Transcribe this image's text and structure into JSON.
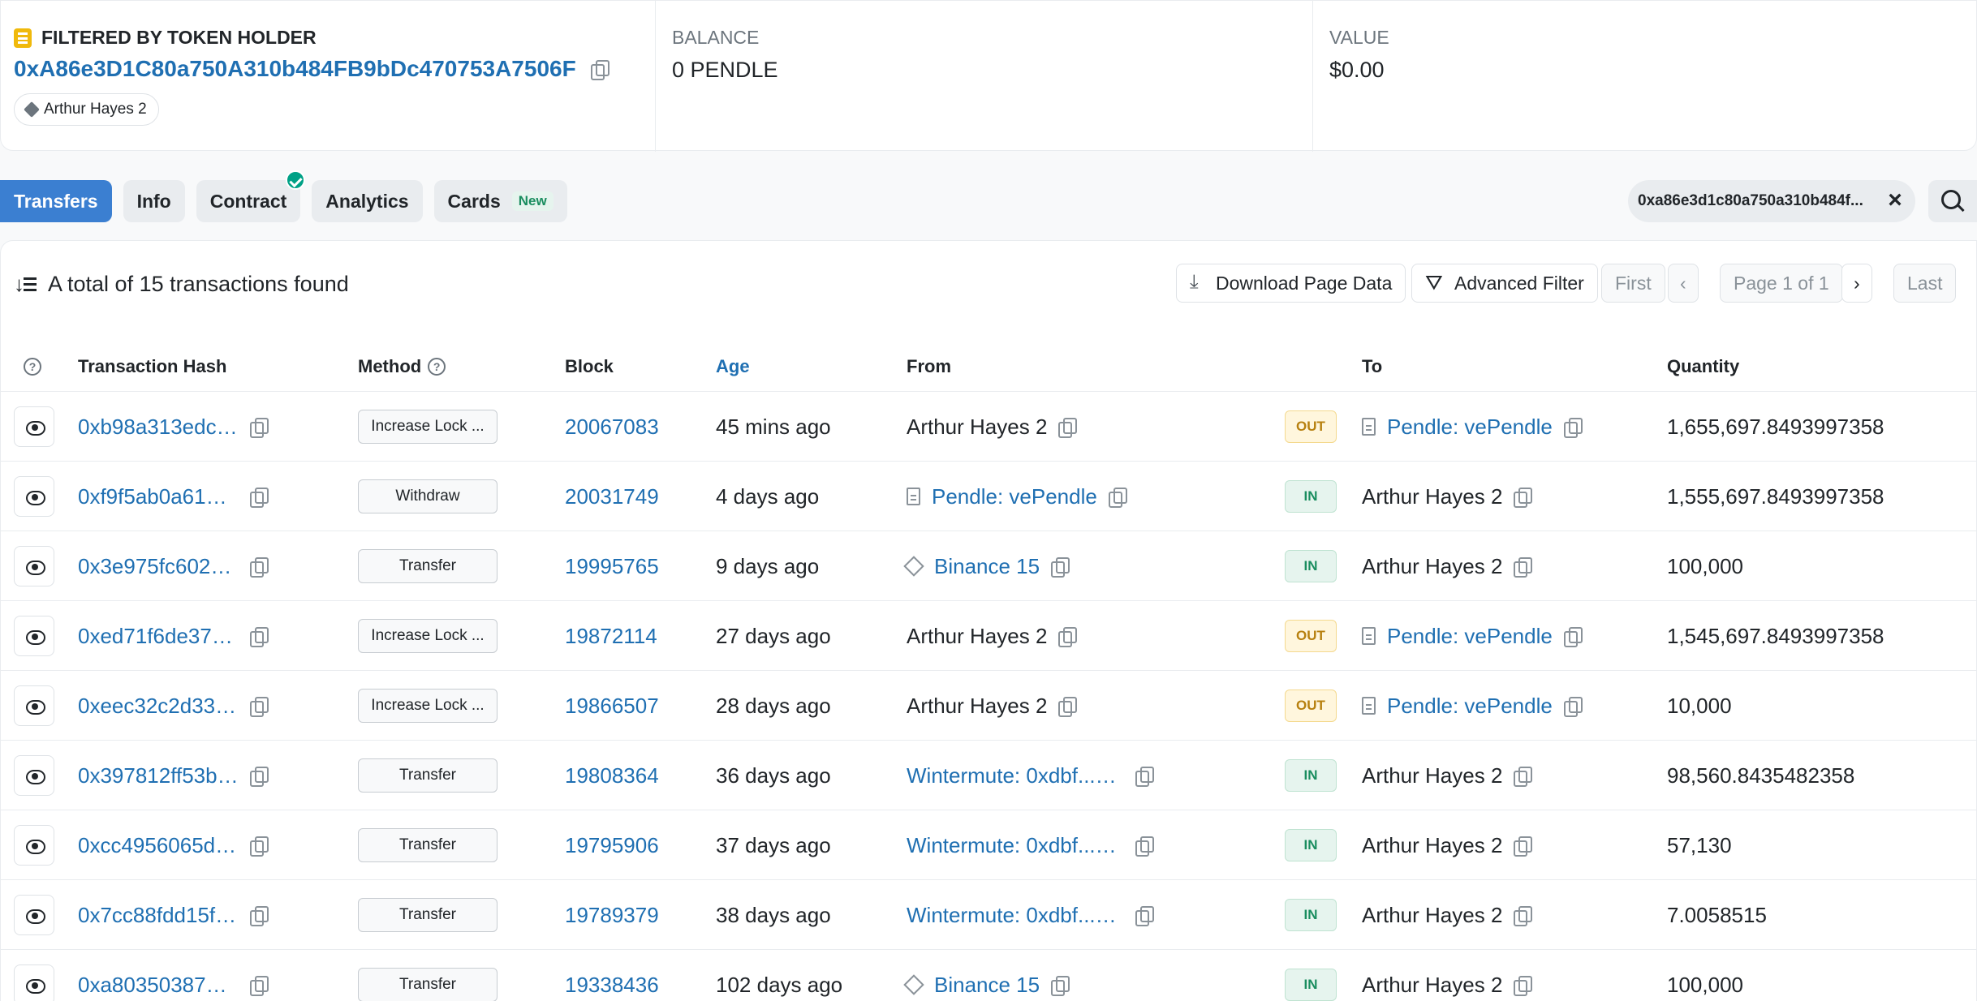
{
  "holder": {
    "heading": "FILTERED BY TOKEN HOLDER",
    "address": "0xA86e3D1C80a750A310b484FB9bDc470753A7506F",
    "tag": "Arthur Hayes 2",
    "balance_label": "BALANCE",
    "balance_value": "0 PENDLE",
    "value_label": "VALUE",
    "value_value": "$0.00"
  },
  "tabs": {
    "transfers": "Transfers",
    "info": "Info",
    "contract": "Contract",
    "analytics": "Analytics",
    "cards": "Cards",
    "cards_badge": "New"
  },
  "filter_chip": "0xa86e3d1c80a750a310b484f...",
  "summary": "A total of 15 transactions found",
  "toolbar": {
    "download": "Download Page Data",
    "advanced_filter": "Advanced Filter",
    "first": "First",
    "prev": "‹",
    "page": "Page 1 of 1",
    "next": "›",
    "last": "Last"
  },
  "columns": {
    "help": "?",
    "hash": "Transaction Hash",
    "method": "Method",
    "block": "Block",
    "age": "Age",
    "from": "From",
    "to": "To",
    "quantity": "Quantity"
  },
  "rows": [
    {
      "hash": "0xb98a313edc…",
      "method": "Increase Lock ...",
      "block": "20067083",
      "age": "45 mins ago",
      "from": "Arthur Hayes 2",
      "from_type": "plain",
      "dir": "OUT",
      "to": "Pendle: vePendle",
      "to_type": "contract",
      "qty": "1,655,697.8493997358"
    },
    {
      "hash": "0xf9f5ab0a61e…",
      "method": "Withdraw",
      "block": "20031749",
      "age": "4 days ago",
      "from": "Pendle: vePendle",
      "from_type": "contract",
      "dir": "IN",
      "to": "Arthur Hayes 2",
      "to_type": "plain",
      "qty": "1,555,697.8493997358"
    },
    {
      "hash": "0x3e975fc6024…",
      "method": "Transfer",
      "block": "19995765",
      "age": "9 days ago",
      "from": "Binance 15",
      "from_type": "exchange",
      "dir": "IN",
      "to": "Arthur Hayes 2",
      "to_type": "plain",
      "qty": "100,000"
    },
    {
      "hash": "0xed71f6de378…",
      "method": "Increase Lock ...",
      "block": "19872114",
      "age": "27 days ago",
      "from": "Arthur Hayes 2",
      "from_type": "plain",
      "dir": "OUT",
      "to": "Pendle: vePendle",
      "to_type": "contract",
      "qty": "1,545,697.8493997358"
    },
    {
      "hash": "0xeec32c2d33…",
      "method": "Increase Lock ...",
      "block": "19866507",
      "age": "28 days ago",
      "from": "Arthur Hayes 2",
      "from_type": "plain",
      "dir": "OUT",
      "to": "Pendle: vePendle",
      "to_type": "contract",
      "qty": "10,000"
    },
    {
      "hash": "0x397812ff53b…",
      "method": "Transfer",
      "block": "19808364",
      "age": "36 days ago",
      "from": "Wintermute: 0xdbf...0…",
      "from_type": "link",
      "dir": "IN",
      "to": "Arthur Hayes 2",
      "to_type": "plain",
      "qty": "98,560.8435482358"
    },
    {
      "hash": "0xcc4956065d…",
      "method": "Transfer",
      "block": "19795906",
      "age": "37 days ago",
      "from": "Wintermute: 0xdbf...0…",
      "from_type": "link",
      "dir": "IN",
      "to": "Arthur Hayes 2",
      "to_type": "plain",
      "qty": "57,130"
    },
    {
      "hash": "0x7cc88fdd15f…",
      "method": "Transfer",
      "block": "19789379",
      "age": "38 days ago",
      "from": "Wintermute: 0xdbf...0…",
      "from_type": "link",
      "dir": "IN",
      "to": "Arthur Hayes 2",
      "to_type": "plain",
      "qty": "7.0058515"
    },
    {
      "hash": "0xa803503879…",
      "method": "Transfer",
      "block": "19338436",
      "age": "102 days ago",
      "from": "Binance 15",
      "from_type": "exchange",
      "dir": "IN",
      "to": "Arthur Hayes 2",
      "to_type": "plain",
      "qty": "100,000"
    }
  ]
}
